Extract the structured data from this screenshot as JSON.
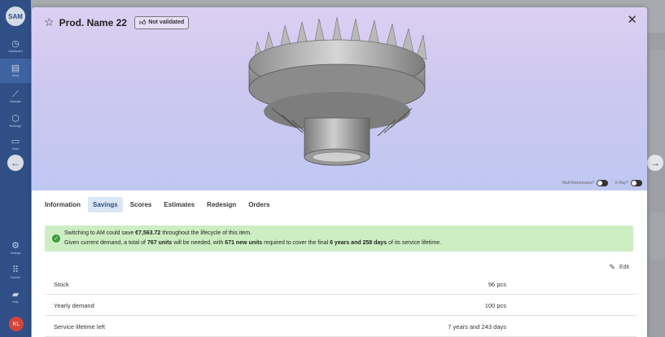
{
  "sidebar": {
    "logo": "SAM",
    "items": [
      {
        "icon": "dashboard-icon",
        "glyph": "◷",
        "label": "Dashboard"
      },
      {
        "icon": "items-icon",
        "glyph": "▤",
        "label": "Items"
      },
      {
        "icon": "estimate-icon",
        "glyph": "⟋",
        "label": "Estimate"
      },
      {
        "icon": "redesign-icon",
        "glyph": "⬡",
        "label": "Redesign"
      },
      {
        "icon": "order-icon",
        "glyph": "▭",
        "label": "Order"
      },
      {
        "icon": "settings-icon",
        "glyph": "⚙",
        "label": "Settings"
      },
      {
        "icon": "explore-icon",
        "glyph": "⠿",
        "label": "Explore"
      },
      {
        "icon": "help-icon",
        "glyph": "▰",
        "label": "Help"
      }
    ],
    "avatar": "KL"
  },
  "modal": {
    "title": "Prod. Name 22",
    "badge": "Not validated",
    "toggles": {
      "wall_thickness": "Wall thicknesses?",
      "xray": "X-Ray?"
    },
    "tabs": [
      "Information",
      "Savings",
      "Scores",
      "Estimates",
      "Redesign",
      "Orders"
    ],
    "active_tab": "Savings",
    "banner": {
      "l1_a": "Switching to AM could save ",
      "l1_b": "€7,563.72",
      "l1_c": " throughout the lifecycle of this item.",
      "l2_a": "Given current demand, a total of ",
      "l2_b": "767 units",
      "l2_c": " will be needed, with ",
      "l2_d": "671 new units",
      "l2_e": " required to cover the final ",
      "l2_f": "6 years and 258 days",
      "l2_g": " of its service lifetime."
    },
    "edit_label": "Edit",
    "rows": [
      {
        "label": "Stock",
        "value": "96 pcs"
      },
      {
        "label": "Yearly demand",
        "value": "100 pcs"
      },
      {
        "label": "Service lifetime left",
        "value": "7 years and 243 days"
      }
    ]
  },
  "colors": {
    "sidebar": "#2f4f86",
    "accent": "#2f4f86",
    "success_bg": "#cdeec3",
    "success_icon": "#3a9a3a"
  }
}
